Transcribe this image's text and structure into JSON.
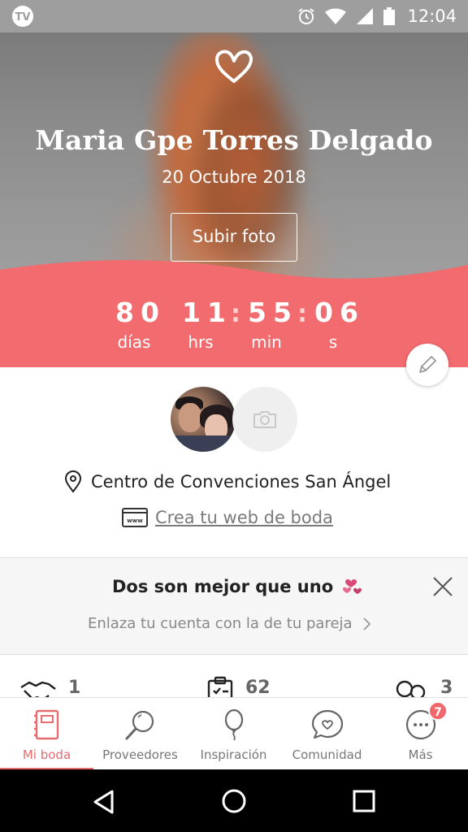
{
  "status_bar": {
    "time": "12:04",
    "icons": [
      "alarm-icon",
      "wifi-icon",
      "signal-icon",
      "battery-icon"
    ]
  },
  "hero": {
    "couple_name": "Maria Gpe Torres Delgado",
    "wedding_date": "20 Octubre 2018",
    "upload_photo_label": "Subir foto"
  },
  "countdown": {
    "days": "80",
    "hours": "11",
    "minutes": "55",
    "seconds": "06",
    "days_label": "días",
    "hours_label": "hrs",
    "minutes_label": "min",
    "seconds_label": "s",
    "separator": ":"
  },
  "profile": {
    "venue": "Centro de Convenciones San Ángel",
    "website_link": "Crea tu web de boda"
  },
  "partner_card": {
    "title": "Dos son mejor que uno",
    "subtitle": "Enlaza tu cuenta con la de tu pareja"
  },
  "stats": [
    {
      "icon": "handshake-icon",
      "value": "1"
    },
    {
      "icon": "clipboard-icon",
      "value": "62"
    },
    {
      "icon": "guests-icon",
      "value": "3"
    }
  ],
  "bottom_nav": {
    "items": [
      {
        "label": "Mi boda",
        "icon": "notebook-icon",
        "active": true
      },
      {
        "label": "Proveedores",
        "icon": "search-icon"
      },
      {
        "label": "Inspiración",
        "icon": "balloon-icon"
      },
      {
        "label": "Comunidad",
        "icon": "chat-heart-icon"
      },
      {
        "label": "Más",
        "icon": "more-icon",
        "badge": "7"
      }
    ]
  },
  "colors": {
    "accent": "#f26b6e",
    "accent_dark": "#e56c6f",
    "status_bar": "#9e9e9e"
  }
}
